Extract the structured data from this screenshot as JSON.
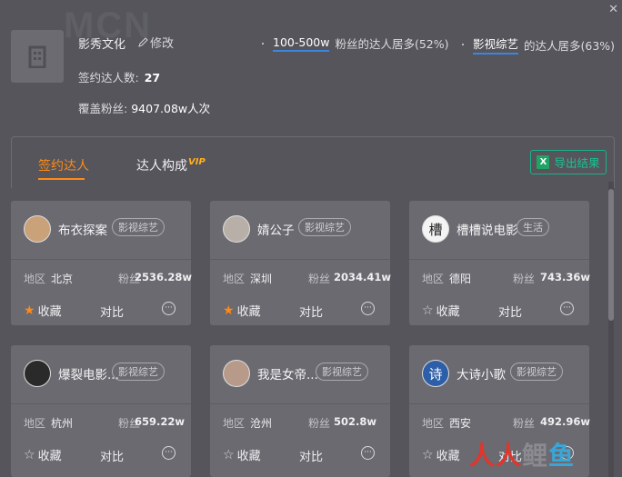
{
  "watermark": "MCN",
  "org": {
    "name": "影秀文化",
    "edit_label": "修改",
    "signed_label": "签约达人数:",
    "signed_value": "27",
    "coverage_label": "覆盖粉丝:",
    "coverage_value": "9407.08w人次"
  },
  "highlights": [
    {
      "value": "100-500w",
      "text": "粉丝的达人居多(52%)"
    },
    {
      "value": "影视综艺",
      "text": "的达人居多(63%)"
    }
  ],
  "tabs": {
    "signed": "签约达人",
    "composition": "达人构成",
    "vip": "VIP"
  },
  "export_label": "导出结果",
  "card_labels": {
    "region": "地区",
    "fans": "粉丝",
    "favorite": "收藏",
    "compare": "对比",
    "more": "···"
  },
  "cards": [
    {
      "name": "布衣探案",
      "tag": "影视综艺",
      "region": "北京",
      "fans": "2536.28w",
      "favorited": true
    },
    {
      "name": "婧公子",
      "tag": "影视综艺",
      "region": "深圳",
      "fans": "2034.41w",
      "favorited": true
    },
    {
      "name": "槽槽说电影",
      "tag": "生活",
      "region": "德阳",
      "fans": "743.36w",
      "favorited": false
    },
    {
      "name": "爆裂电影...",
      "tag": "影视综艺",
      "region": "杭州",
      "fans": "659.22w",
      "favorited": false
    },
    {
      "name": "我是女帝...",
      "tag": "影视综艺",
      "region": "沧州",
      "fans": "502.8w",
      "favorited": false
    },
    {
      "name": "大诗小歌",
      "tag": "影视综艺",
      "region": "西安",
      "fans": "492.96w",
      "favorited": false
    }
  ],
  "site_watermark": [
    "人",
    "人",
    "鲤",
    "鱼"
  ],
  "colors": {
    "accent": "#ff8a17",
    "export": "#19c392",
    "link_underline": "#3a86e0"
  }
}
